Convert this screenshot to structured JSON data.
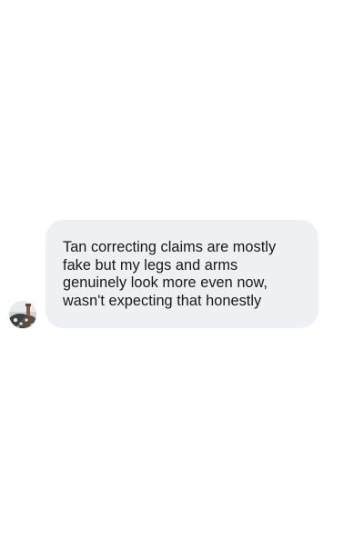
{
  "conversation": {
    "messages": [
      {
        "direction": "incoming",
        "avatar_icon": "user-avatar-photo",
        "text": "Tan correcting claims are mostly\nfake but my legs and arms\ngenuinely look more even now,\nwasn't expecting that honestly"
      }
    ]
  },
  "colors": {
    "page_background": "#ffffff",
    "bubble_background": "#eff0f4",
    "text": "#17181a"
  }
}
